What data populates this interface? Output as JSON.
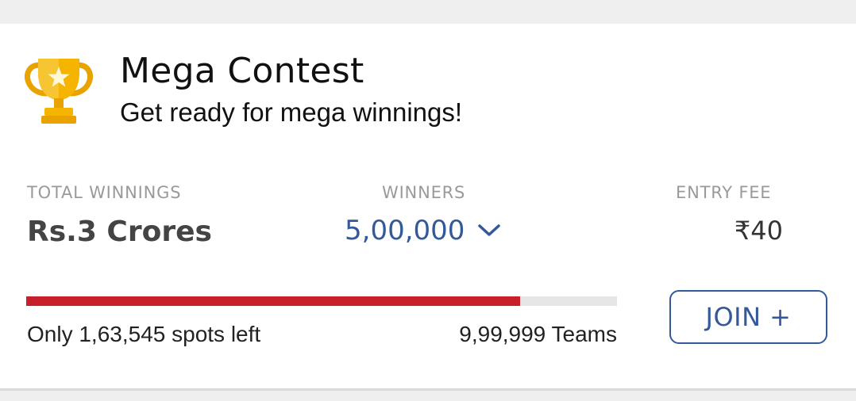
{
  "contest": {
    "title": "Mega Contest",
    "subtitle": "Get ready for mega winnings!",
    "icon": "trophy-icon"
  },
  "stats": {
    "total_winnings_label": "TOTAL WINNINGS",
    "total_winnings_value": "Rs.3 Crores",
    "winners_label": "WINNERS",
    "winners_value": "5,00,000",
    "winners_icon": "chevron-down-icon",
    "entry_fee_label": "ENTRY FEE",
    "entry_fee_value": "₹40"
  },
  "progress": {
    "filled_fraction": 0.836,
    "spots_left_text": "Only 1,63,545 spots left",
    "teams_text": "9,99,999 Teams"
  },
  "actions": {
    "join_label": "JOIN +"
  },
  "colors": {
    "accent_blue": "#33599a",
    "progress_red": "#c8202b",
    "trophy_gold": "#f4b400"
  }
}
